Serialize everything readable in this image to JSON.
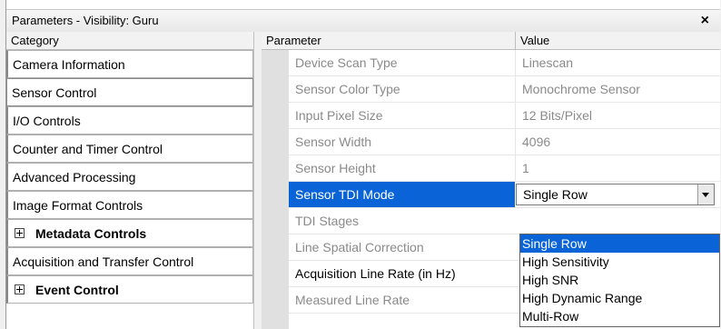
{
  "window": {
    "title": "Parameters - Visibility: Guru",
    "close_glyph": "×"
  },
  "category_pane": {
    "header": "Category",
    "items": [
      {
        "label": "Camera Information",
        "expandable": false
      },
      {
        "label": "Sensor Control",
        "expandable": false,
        "selected": true
      },
      {
        "label": "I/O Controls",
        "expandable": false
      },
      {
        "label": "Counter and Timer Control",
        "expandable": false
      },
      {
        "label": "Advanced Processing",
        "expandable": false
      },
      {
        "label": "Image Format Controls",
        "expandable": false
      },
      {
        "label": "Metadata Controls",
        "expandable": true
      },
      {
        "label": "Acquisition and Transfer Control",
        "expandable": false
      },
      {
        "label": "Event Control",
        "expandable": true
      }
    ]
  },
  "grid": {
    "header_parameter": "Parameter",
    "header_value": "Value",
    "rows": [
      {
        "parameter": "Device Scan Type",
        "value": "Linescan"
      },
      {
        "parameter": "Sensor Color Type",
        "value": "Monochrome Sensor"
      },
      {
        "parameter": "Input Pixel Size",
        "value": "12 Bits/Pixel"
      },
      {
        "parameter": "Sensor Width",
        "value": "4096"
      },
      {
        "parameter": "Sensor Height",
        "value": "1"
      },
      {
        "parameter": "Sensor TDI Mode",
        "value": "Single Row"
      },
      {
        "parameter": "TDI Stages",
        "value": ""
      },
      {
        "parameter": "Line Spatial Correction",
        "value": ""
      },
      {
        "parameter": "Acquisition Line Rate (in Hz)",
        "value": ""
      },
      {
        "parameter": "Measured Line Rate",
        "value": ""
      }
    ]
  },
  "dropdown": {
    "options": [
      "Single Row",
      "High Sensitivity",
      "High SNR",
      "High Dynamic Range",
      "Multi-Row"
    ],
    "highlighted": "Single Row"
  },
  "colors": {
    "selection": "#0a64d7",
    "disabled_text": "#8a8a8a"
  }
}
